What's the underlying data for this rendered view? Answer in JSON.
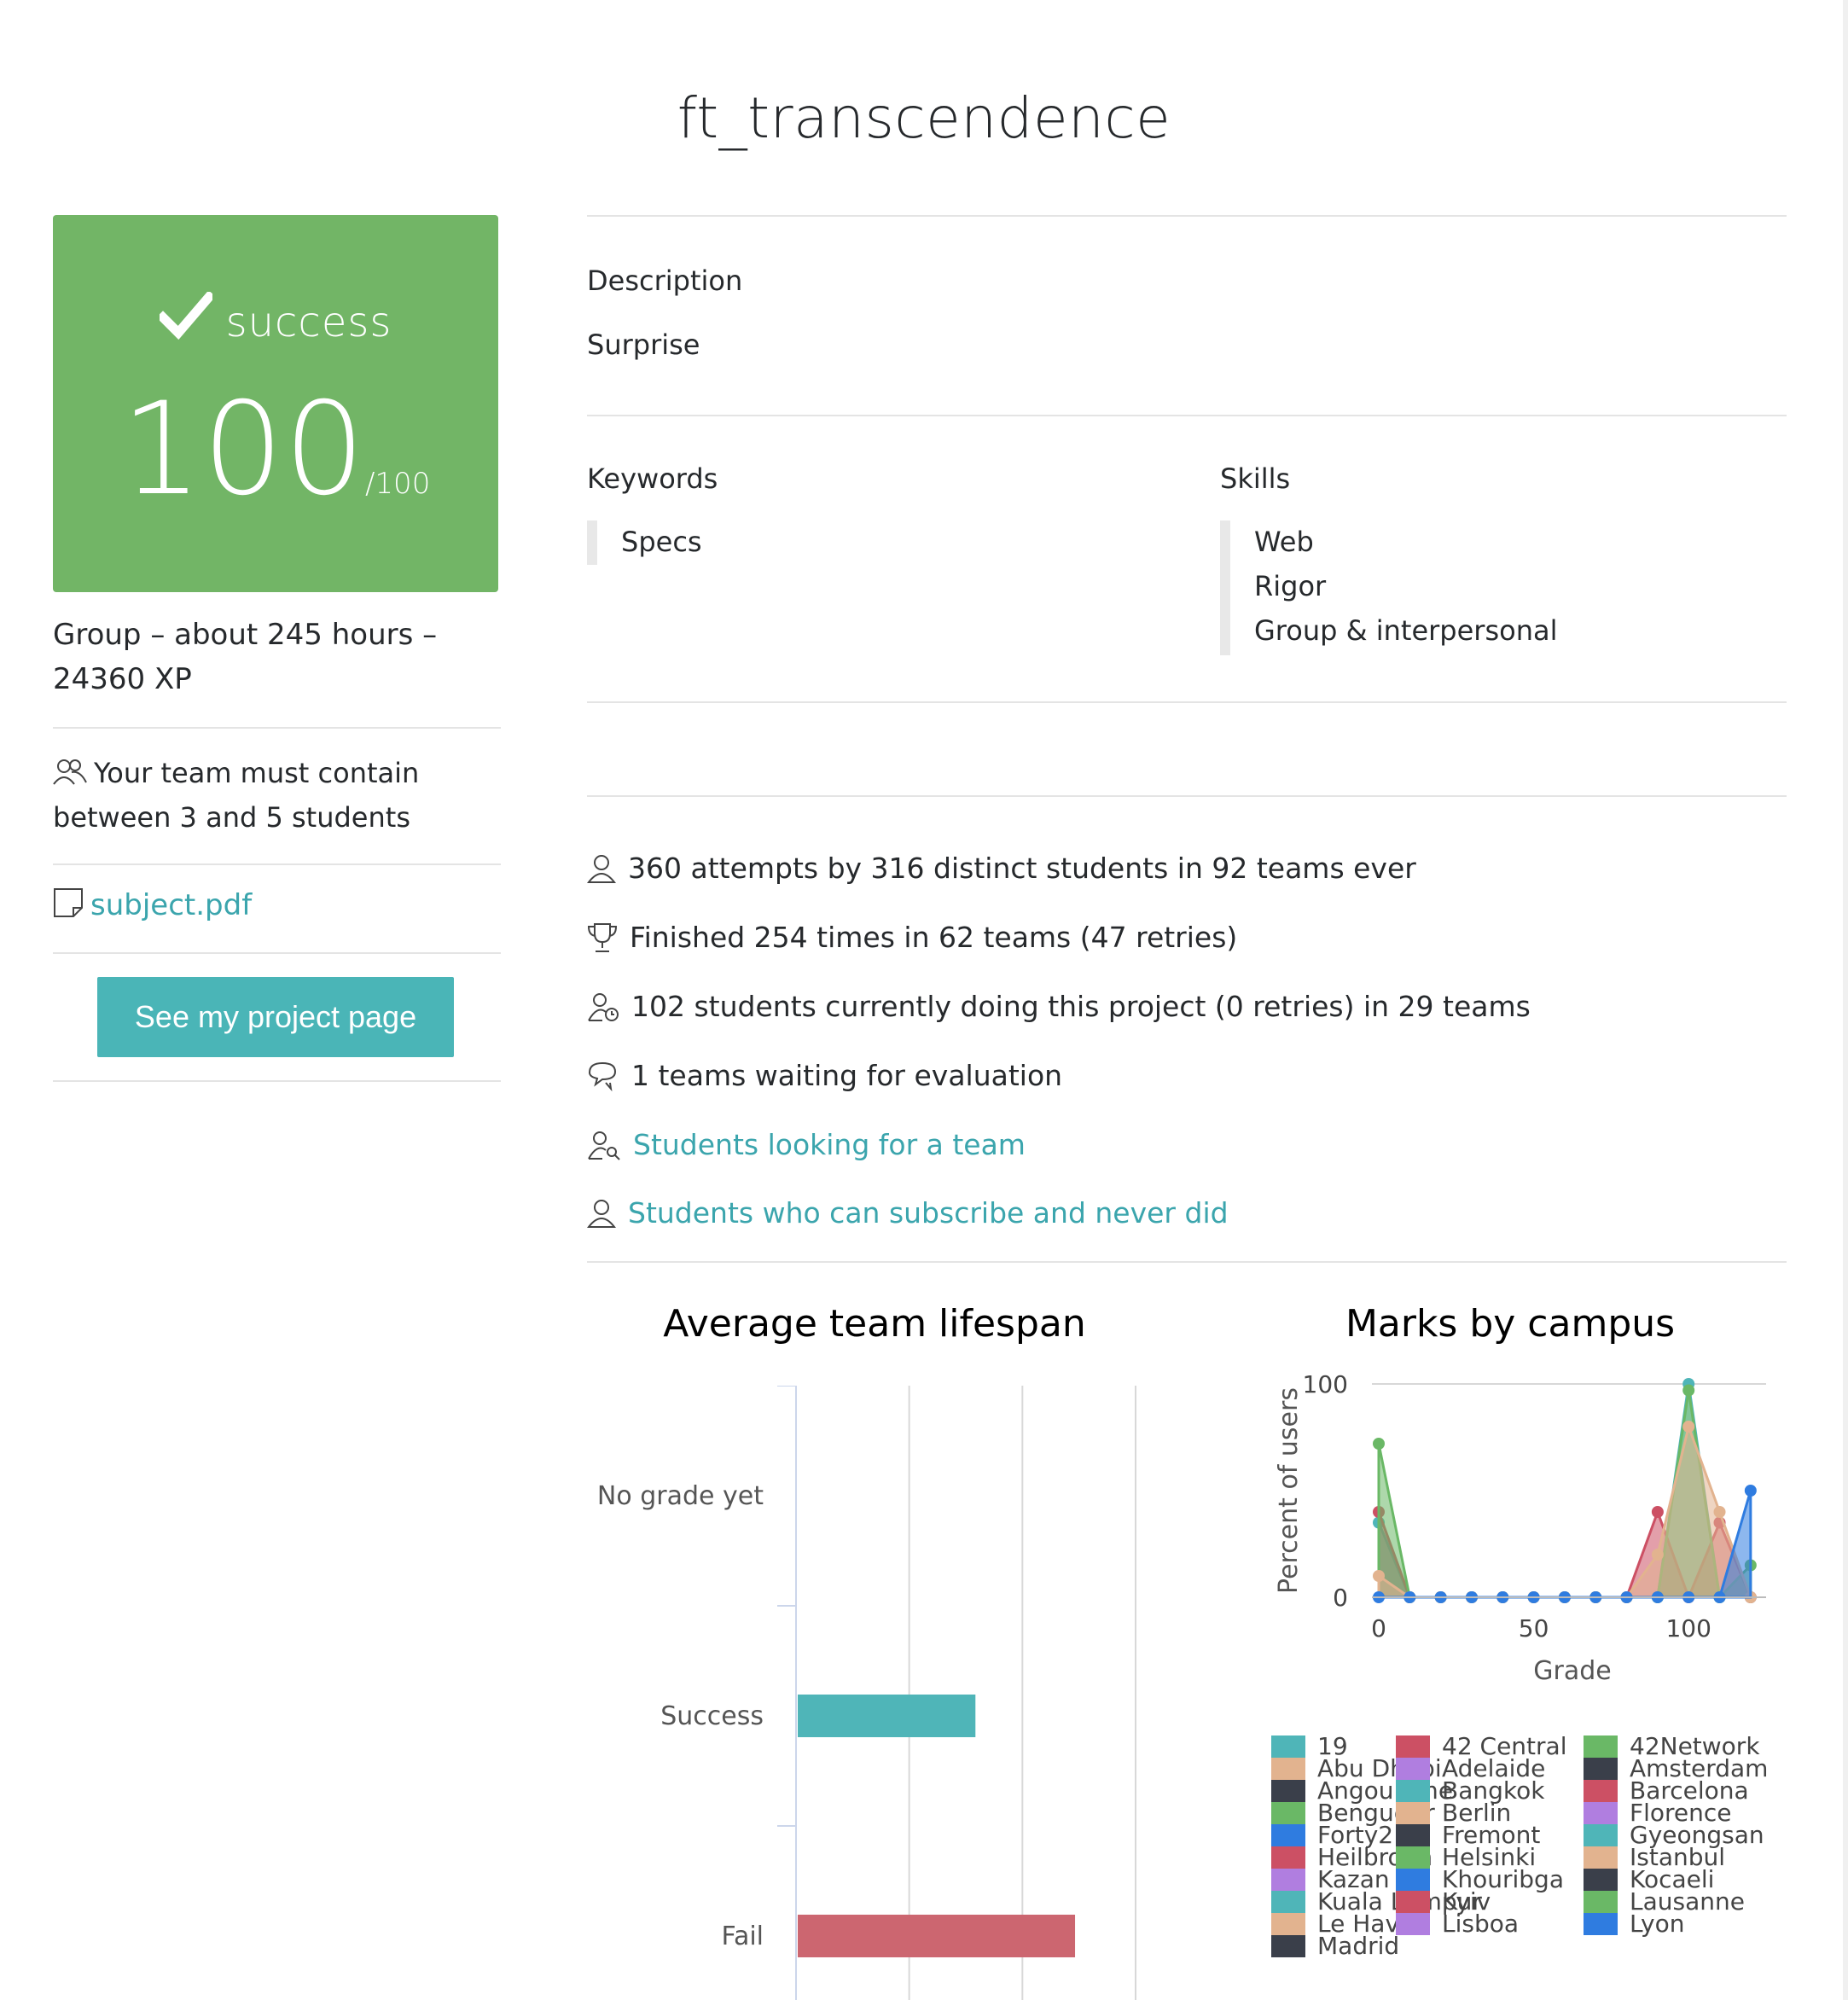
{
  "project": {
    "title": "ft_transcendence"
  },
  "grade": {
    "status": "success",
    "score": "100",
    "max": "/100"
  },
  "meta": {
    "summary": "Group – about 245 hours – 24360 XP"
  },
  "team_rule": "Your team must contain between 3 and 5 students",
  "subject_link": "subject.pdf",
  "project_page_button": "See my project page",
  "description": {
    "label": "Description",
    "value": "Surprise"
  },
  "keywords": {
    "label": "Keywords",
    "items": [
      "Specs"
    ]
  },
  "skills": {
    "label": "Skills",
    "items": [
      "Web",
      "Rigor",
      "Group & interpersonal"
    ]
  },
  "stats": [
    {
      "icon": "user-icon",
      "text": "360 attempts by 316 distinct students in 92 teams ever",
      "link": false
    },
    {
      "icon": "trophy-icon",
      "text": "Finished 254 times in 62 teams (47 retries)",
      "link": false
    },
    {
      "icon": "user-clock-icon",
      "text": "102 students currently doing this project (0 retries) in 29 teams",
      "link": false
    },
    {
      "icon": "speech-bubbles-icon",
      "text": "1 teams waiting for evaluation",
      "link": false
    },
    {
      "icon": "user-search-icon",
      "text": "Students looking for a team",
      "link": true
    },
    {
      "icon": "user-icon",
      "text": "Students who can subscribe and never did",
      "link": true
    }
  ],
  "colors": {
    "success_green": "#72b566",
    "link_teal": "#3ba5ad",
    "button_teal": "#4ab5b7",
    "bar_success": "#4fb5b8",
    "bar_fail": "#cc6670"
  },
  "chart_data": [
    {
      "type": "bar",
      "orientation": "horizontal",
      "title": "Average team lifespan",
      "categories": [
        "No grade yet",
        "Success",
        "Fail"
      ],
      "values": [
        0,
        1.57,
        2.45
      ],
      "bar_colors": [
        "#4fb5b8",
        "#4fb5b8",
        "#cc6670"
      ],
      "xlim": [
        0,
        3
      ],
      "grid": true
    },
    {
      "type": "area",
      "title": "Marks by campus",
      "xlabel": "Grade",
      "ylabel": "Percent of users",
      "xlim": [
        0,
        125
      ],
      "ylim": [
        0,
        100
      ],
      "xticks": [
        "0",
        "50",
        "100"
      ],
      "yticks": [
        "0",
        "100"
      ],
      "x": [
        0,
        10,
        20,
        30,
        40,
        50,
        60,
        70,
        80,
        90,
        100,
        110,
        120
      ],
      "series": [
        {
          "name": "19",
          "color": "#4fb5b8",
          "values": [
            35,
            0,
            0,
            0,
            0,
            0,
            0,
            0,
            0,
            0,
            100,
            0,
            0
          ]
        },
        {
          "name": "42 Central",
          "color": "#cc5064",
          "values": [
            40,
            0,
            0,
            0,
            0,
            0,
            0,
            0,
            0,
            40,
            0,
            35,
            0
          ]
        },
        {
          "name": "42Network",
          "color": "#6ab866",
          "values": [
            72,
            0,
            0,
            0,
            0,
            0,
            0,
            0,
            0,
            0,
            97,
            0,
            15
          ]
        },
        {
          "name": "Abu Dhabi",
          "color": "#e2b38f",
          "values": [
            10,
            0,
            0,
            0,
            0,
            0,
            0,
            0,
            0,
            20,
            80,
            40,
            0
          ]
        },
        {
          "name": "Kazan",
          "color": "#2f7ce0",
          "values": [
            0,
            0,
            0,
            0,
            0,
            0,
            0,
            0,
            0,
            0,
            0,
            0,
            50
          ]
        }
      ],
      "legend": [
        "19",
        "42 Central",
        "42Network",
        "Abu Dhabi",
        "Adelaide",
        "Amsterdam",
        "Angouleme",
        "Bangkok",
        "Barcelona",
        "Benguerir",
        "Berlin",
        "Florence",
        "Forty2",
        "Fremont",
        "Gyeongsan",
        "Heilbronn",
        "Helsinki",
        "Istanbul",
        "Kazan",
        "Khouribga",
        "Kocaeli",
        "Kuala Lumpur",
        "Kyiv",
        "Lausanne",
        "Le Havre",
        "Lisboa",
        "Lyon",
        "Madrid"
      ],
      "legend_colors": [
        "#4fb5b8",
        "#cc5064",
        "#6ab866",
        "#e2b38f",
        "#b07ee0",
        "#3a3f4a",
        "#3a3f4a",
        "#4fb5b8",
        "#cc5064",
        "#6ab866",
        "#e2b38f",
        "#b07ee0",
        "#2f7ce0",
        "#3a3f4a",
        "#4fb5b8",
        "#cc5064",
        "#6ab866",
        "#e2b38f",
        "#b07ee0",
        "#2f7ce0",
        "#3a3f4a",
        "#4fb5b8",
        "#cc5064",
        "#6ab866",
        "#e2b38f",
        "#b07ee0",
        "#2f7ce0",
        "#3a3f4a"
      ],
      "legend_placement": "bottom"
    }
  ]
}
